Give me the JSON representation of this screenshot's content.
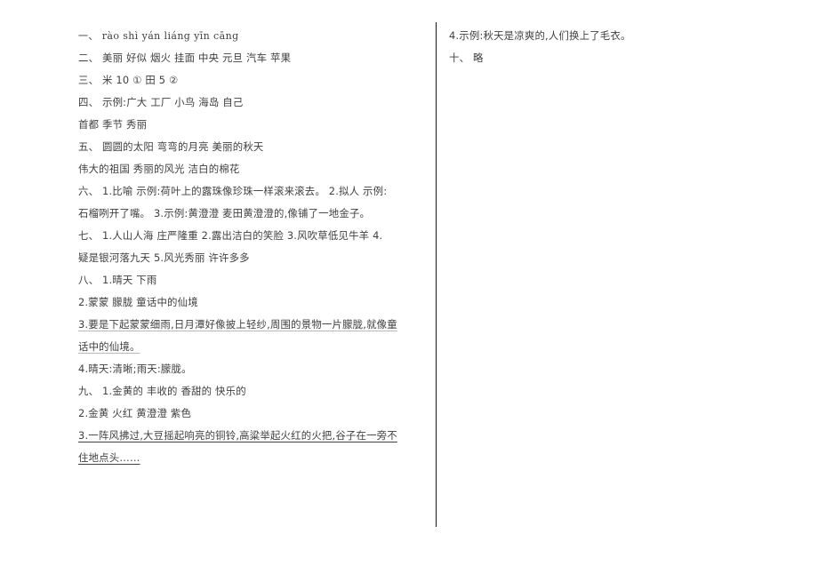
{
  "document": {
    "type": "answer-key",
    "page_background": "#ffffff",
    "text_color": "#3f3f3f",
    "divider_color": "#1b1b1b"
  },
  "left_column": {
    "lines": [
      {
        "id": "l1",
        "text": "一、  ràο  shì  yán  liáng  yīn  cāng",
        "style": "pinyin"
      },
      {
        "id": "l2",
        "text": "二、  美丽  好似  烟火  挂面  中央  元旦  汽车  苹果",
        "style": "normal"
      },
      {
        "id": "l3",
        "text": "三、  米  10  ①  田  5  ②",
        "style": "normal"
      },
      {
        "id": "l4",
        "text": "四、  示例:广大  工厂  小鸟  海岛  自己",
        "style": "normal"
      },
      {
        "id": "l5",
        "text": "首都  季节  秀丽",
        "style": "normal"
      },
      {
        "id": "l6",
        "text": "五、  圆圆的太阳  弯弯的月亮  美丽的秋天",
        "style": "normal"
      },
      {
        "id": "l7",
        "text": "伟大的祖国  秀丽的风光  洁白的棉花",
        "style": "normal"
      },
      {
        "id": "l8",
        "text": "六、  1.比喻  示例:荷叶上的露珠像珍珠一样滚来滚去。  2.拟人  示例:",
        "style": "normal"
      },
      {
        "id": "l9",
        "text": "石榴咧开了嘴。   3.示例:黄澄澄  麦田黄澄澄的,像铺了一地金子。",
        "style": "normal"
      },
      {
        "id": "l10",
        "text": "七、  1.人山人海  庄严隆重  2.露出洁白的笑脸  3.风吹草低见牛羊  4.",
        "style": "normal"
      },
      {
        "id": "l11",
        "text": "疑是银河落九天  5.风光秀丽  许许多多",
        "style": "normal"
      },
      {
        "id": "l12",
        "text": "八、  1.晴天  下雨",
        "style": "normal"
      },
      {
        "id": "l13",
        "text": "2.蒙蒙  朦胧  童话中的仙境",
        "style": "normal"
      },
      {
        "id": "l14",
        "text": "3.要是下起蒙蒙细雨,日月潭好像披上轻纱,周围的景物一片朦胧,就像童",
        "style": "underline-soft"
      },
      {
        "id": "l15",
        "text": "话中的仙境。",
        "style": "underline-soft"
      },
      {
        "id": "l16",
        "text": "4.晴天:清晰;雨天:朦胧。",
        "style": "normal"
      },
      {
        "id": "l17",
        "text": "九、  1.金黄的  丰收的  香甜的  快乐的",
        "style": "normal"
      },
      {
        "id": "l18",
        "text": "2.金黄  火红  黄澄澄  紫色",
        "style": "normal"
      },
      {
        "id": "l19",
        "text": "3.一阵风拂过,大豆摇起响亮的铜铃,高粱举起火红的火把,谷子在一旁不",
        "style": "underlined"
      },
      {
        "id": "l20",
        "text": "住地点头……",
        "style": "underlined"
      }
    ]
  },
  "right_column": {
    "lines": [
      {
        "id": "r1",
        "text": "4.示例:秋天是凉爽的,人们换上了毛衣。",
        "style": "normal"
      },
      {
        "id": "r2",
        "text": "十、  略",
        "style": "normal"
      }
    ]
  }
}
